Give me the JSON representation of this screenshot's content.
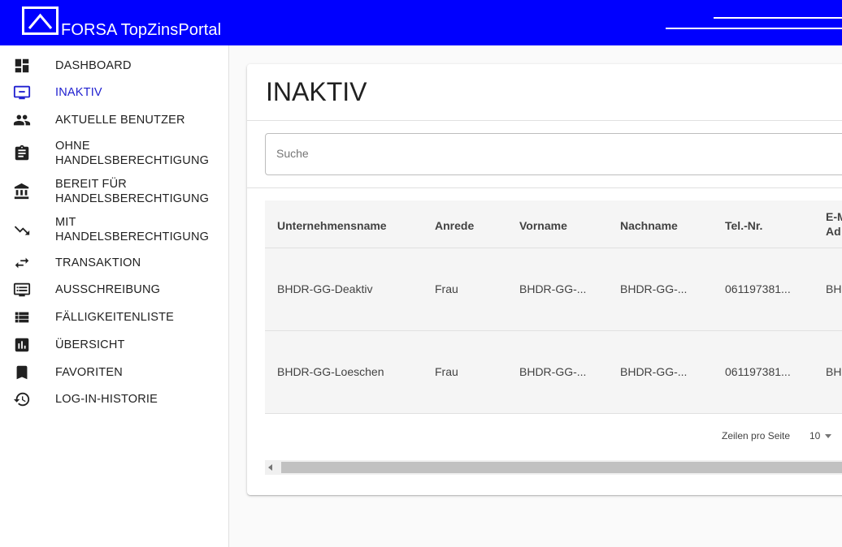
{
  "app": {
    "brand": "FORSA TopZinsPortal",
    "accent_color": "#0000ff",
    "active_color": "#2020d0"
  },
  "sidebar": {
    "items": [
      {
        "label": "DASHBOARD",
        "icon": "dashboard-icon"
      },
      {
        "label": "INAKTIV",
        "icon": "monitor-icon",
        "active": true
      },
      {
        "label": "AKTUELLE BENUTZER",
        "icon": "people-icon"
      },
      {
        "label": "OHNE\nHANDELSBERECHTIGUNG",
        "icon": "clipboard-icon"
      },
      {
        "label": "BEREIT FÜR\nHANDELSBERECHTIGUNG",
        "icon": "bank-icon"
      },
      {
        "label": "MIT\nHANDELSBERECHTIGUNG",
        "icon": "trending-down-icon"
      },
      {
        "label": "TRANSAKTION",
        "icon": "swap-icon"
      },
      {
        "label": "AUSSCHREIBUNG",
        "icon": "message-icon"
      },
      {
        "label": "FÄLLIGKEITENLISTE",
        "icon": "list-icon"
      },
      {
        "label": "ÜBERSICHT",
        "icon": "chart-icon"
      },
      {
        "label": "FAVORITEN",
        "icon": "bookmark-icon"
      },
      {
        "label": "LOG-IN-HISTORIE",
        "icon": "history-icon"
      }
    ]
  },
  "main": {
    "title": "INAKTIV",
    "search": {
      "placeholder": "Suche",
      "value": ""
    },
    "table": {
      "columns": [
        "Unternehmensname",
        "Anrede",
        "Vorname",
        "Nachname",
        "Tel.-Nr.",
        "E-M\nAd"
      ],
      "rows": [
        [
          "BHDR-GG-Deaktiv",
          "Frau",
          "BHDR-GG-...",
          "BHDR-GG-...",
          "061197381...",
          "BH"
        ],
        [
          "BHDR-GG-Loeschen",
          "Frau",
          "BHDR-GG-...",
          "BHDR-GG-...",
          "061197381...",
          "BH"
        ]
      ]
    },
    "pagination": {
      "rows_per_page_label": "Zeilen pro Seite",
      "rows_per_page_value": "10"
    }
  }
}
